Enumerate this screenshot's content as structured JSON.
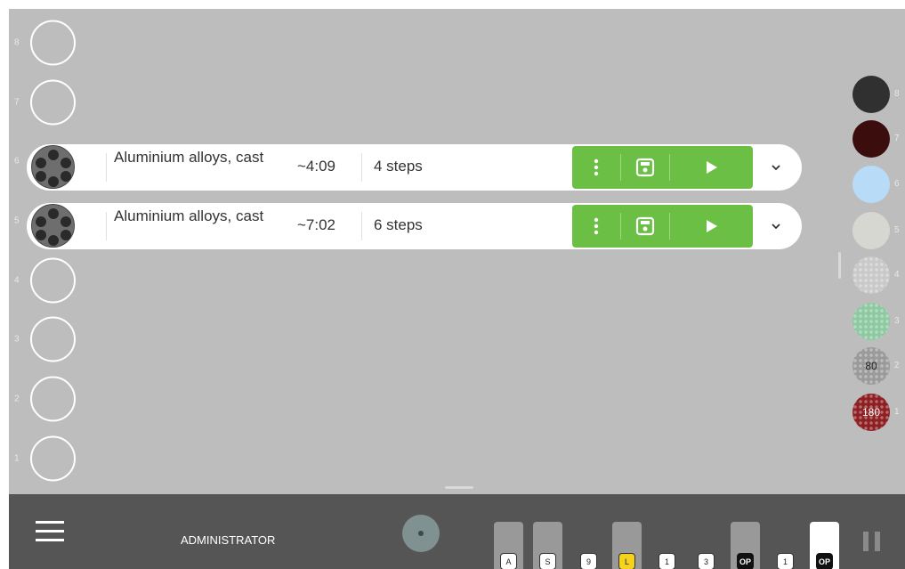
{
  "slots": [
    {
      "number": "8",
      "loaded": false
    },
    {
      "number": "7",
      "loaded": false
    },
    {
      "number": "6",
      "loaded": true
    },
    {
      "number": "5",
      "loaded": true
    },
    {
      "number": "4",
      "loaded": false
    },
    {
      "number": "3",
      "loaded": false
    },
    {
      "number": "2",
      "loaded": false
    },
    {
      "number": "1",
      "loaded": false
    }
  ],
  "jobs": [
    {
      "material": "Aluminium alloys, cast",
      "time": "~4:09",
      "steps": "4 steps"
    },
    {
      "material": "Aluminium alloys, cast",
      "time": "~7:02",
      "steps": "6 steps"
    }
  ],
  "job_action_icons": [
    "more-vertical-icon",
    "save-icon",
    "play-icon",
    "chevron-down-icon"
  ],
  "magazine": [
    {
      "number": "8",
      "label": "",
      "color": "#303030"
    },
    {
      "number": "7",
      "label": "",
      "color": "#3b0d0d"
    },
    {
      "number": "6",
      "label": "",
      "color": "#b8dcf7"
    },
    {
      "number": "5",
      "label": "",
      "color": "#d7d7d2"
    },
    {
      "number": "4",
      "label": "",
      "color": "#c9c9c9"
    },
    {
      "number": "3",
      "label": "",
      "color": "#8ec9a2"
    },
    {
      "number": "2",
      "label": "80",
      "color": "#9a9a9a"
    },
    {
      "number": "1",
      "label": "180",
      "color": "#8e1f22"
    }
  ],
  "bottom_bar": {
    "user": "ADMINISTRATOR",
    "chips": [
      {
        "label": "A",
        "style": "light",
        "tab": "gray"
      },
      {
        "label": "S",
        "style": "light",
        "tab": "gray"
      },
      {
        "label": "9",
        "style": "light",
        "tab": ""
      },
      {
        "label": "L",
        "style": "yellow",
        "tab": "gray"
      },
      {
        "label": "1",
        "style": "light",
        "tab": ""
      },
      {
        "label": "3",
        "style": "light",
        "tab": ""
      },
      {
        "label": "OP",
        "style": "dark",
        "tab": "gray"
      },
      {
        "label": "1",
        "style": "light",
        "tab": ""
      },
      {
        "label": "OP",
        "style": "dark",
        "tab": "white"
      }
    ]
  },
  "colors": {
    "background": "#bdbdbd",
    "accent_green": "#6cbf45",
    "bottom_bar": "#555555"
  }
}
